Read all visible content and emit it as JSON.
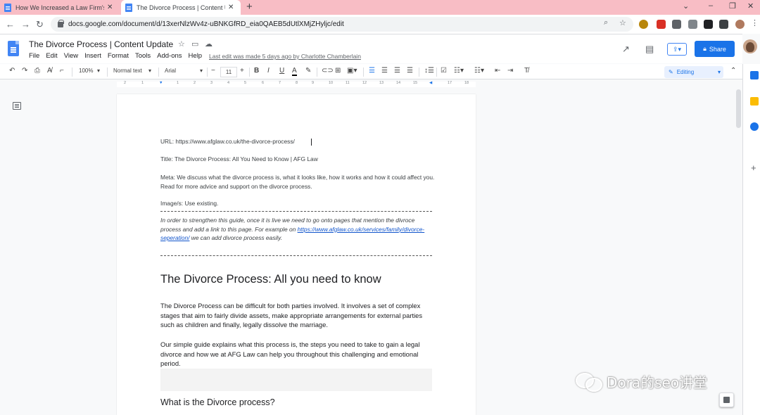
{
  "browser": {
    "tabs": [
      {
        "title": "How We Increased a Law Firm's U",
        "active": false
      },
      {
        "title": "The Divorce Process | Content Up",
        "active": true
      }
    ],
    "new_tab": "+",
    "window_controls": {
      "dropdown": "⌄",
      "minimize": "–",
      "restore": "❐",
      "close": "✕"
    },
    "url": "docs.google.com/document/d/13xerNlzWv4z-uBNKGfRD_eia0QAEB5dUtlXMjZHyljc/edit",
    "nav": {
      "back": "←",
      "forward": "→",
      "reload": "↻"
    }
  },
  "docs": {
    "title": "The Divorce Process | Content Update",
    "menu": [
      "File",
      "Edit",
      "View",
      "Insert",
      "Format",
      "Tools",
      "Add-ons",
      "Help"
    ],
    "last_edit": "Last edit was made 5 days ago by Charlotte Chamberlain",
    "share_label": "Share",
    "toolbar": {
      "zoom": "100%",
      "style": "Normal text",
      "font": "Arial",
      "font_size": "11",
      "mode": "Editing"
    },
    "ruler_ticks": [
      "2",
      "1",
      "1",
      "2",
      "3",
      "4",
      "5",
      "6",
      "7",
      "8",
      "9",
      "10",
      "11",
      "12",
      "13",
      "14",
      "15",
      "17",
      "18"
    ]
  },
  "document": {
    "url_line": "URL: https://www.afglaw.co.uk/the-divorce-process/",
    "title_line": "Title: The Divorce Process: All You Need to Know | AFG Law",
    "meta_line": "Meta: We discuss what the divorce process is, what it looks like, how it works and how it could affect you. Read for more advice and support on the divorce process.",
    "image_line": "Image/s: Use existing.",
    "note_before": "In order to strengthen this guide, once it is live we need to go onto pages that mention the divroce process and add a link to this page. For example on",
    "note_link": "https://www.afglaw.co.uk/services/family/divorce-seperation/",
    "note_after": " we can add divorce process easily.",
    "heading": "The Divorce Process: All you need to know",
    "para1": "The Divorce Process can be difficult for both parties involved. It involves a set of complex stages that aim to fairly divide assets, make appropriate arrangements for external parties such as children and finally, legally dissolve the marriage.",
    "para2": "Our simple guide explains what this process is, the steps you need to take to gain a legal divorce and how we at AFG Law can help you throughout this challenging and emotional period.",
    "subheading": "What is the Divorce process?"
  },
  "watermark": "Dora的seo讲堂",
  "colors": {
    "tabstrip": "#f8bdc5",
    "share": "#1a73e8",
    "link": "#1155cc"
  }
}
